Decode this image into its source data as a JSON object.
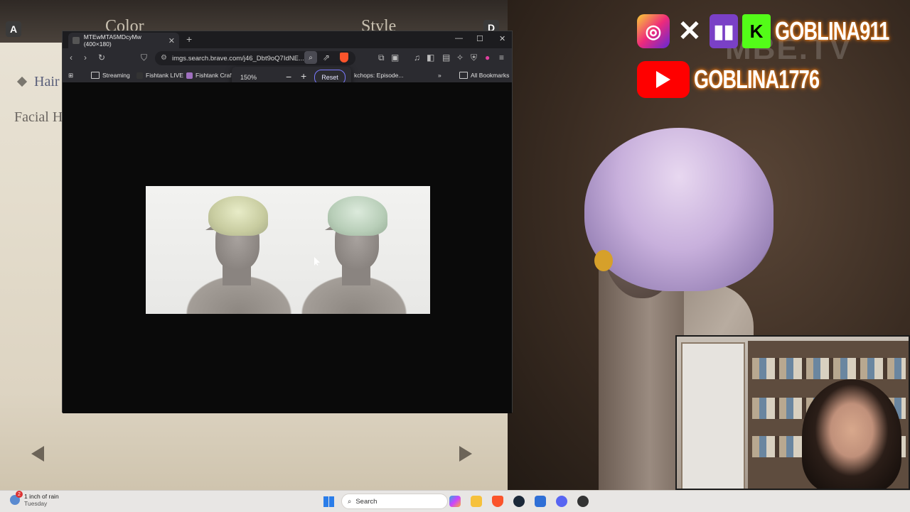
{
  "game": {
    "tab_a": "A",
    "tab_d": "D",
    "color_title": "Color",
    "style_title": "Style",
    "hair_label": "Hair",
    "facial_label": "Facial H"
  },
  "overlay": {
    "instagram_handle": "GOBLINA911",
    "youtube_handle": "GOBLINA1776",
    "watermark": "MBE.TV"
  },
  "browser": {
    "tab_title": "MTEwMTA5MDcyMw (400×180)",
    "url": "imgs.search.brave.com/j46_Dbt9oQ7IdNE...",
    "bookmarks": [
      "Streaming",
      "Fishtank LIVE",
      "Fishtank Craft",
      "kchops: Episode..."
    ],
    "overflow_label": "»",
    "all_bookmarks": "All Bookmarks",
    "zoom": {
      "level": "150%",
      "minus": "−",
      "plus": "+",
      "reset": "Reset"
    }
  },
  "taskbar": {
    "weather_badge": "2",
    "weather_line1": "1 inch of rain",
    "weather_line2": "Tuesday",
    "search_placeholder": "Search"
  }
}
